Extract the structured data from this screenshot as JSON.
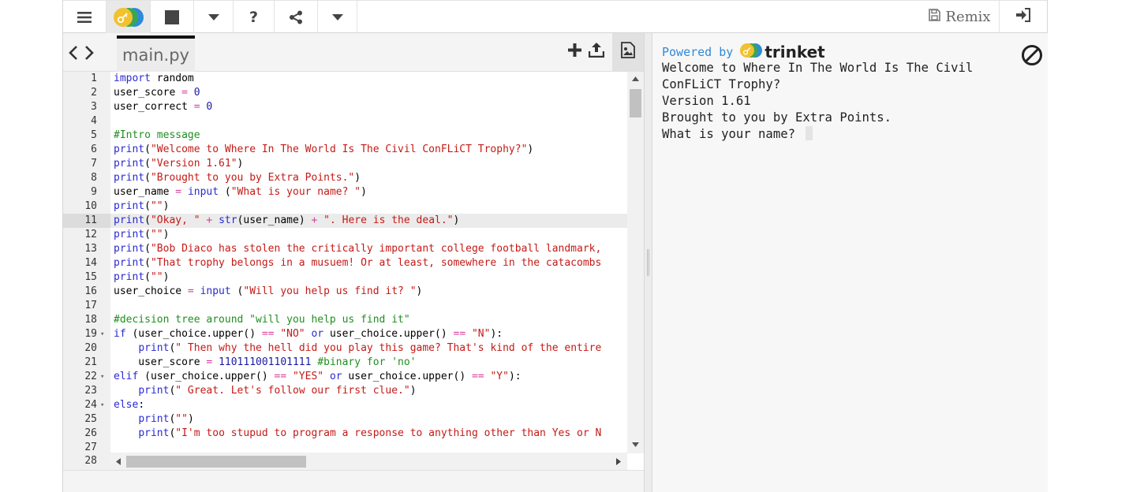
{
  "toolbar": {
    "remix_label": "Remix"
  },
  "editor": {
    "file_tab": "main.py",
    "active_line": 11,
    "last_line_number": "28",
    "lines": [
      {
        "n": "1",
        "fold": "",
        "html": "<span class=\"k\">import</span> random"
      },
      {
        "n": "2",
        "fold": "",
        "html": "user_score <span class=\"o\">=</span> <span class=\"n\">0</span>"
      },
      {
        "n": "3",
        "fold": "",
        "html": "user_correct <span class=\"o\">=</span> <span class=\"n\">0</span>"
      },
      {
        "n": "4",
        "fold": "",
        "html": ""
      },
      {
        "n": "5",
        "fold": "",
        "html": "<span class=\"c\">#Intro message</span>"
      },
      {
        "n": "6",
        "fold": "",
        "html": "<span class=\"k\">print</span>(<span class=\"s\">\"Welcome to Where In The World Is The Civil ConFLiCT Trophy?\"</span>)"
      },
      {
        "n": "7",
        "fold": "",
        "html": "<span class=\"k\">print</span>(<span class=\"s\">\"Version 1.61\"</span>)"
      },
      {
        "n": "8",
        "fold": "",
        "html": "<span class=\"k\">print</span>(<span class=\"s\">\"Brought to you by Extra Points.\"</span>)"
      },
      {
        "n": "9",
        "fold": "",
        "html": "user_name <span class=\"o\">=</span> <span class=\"k\">input</span> (<span class=\"s\">\"What is your name? \"</span>)"
      },
      {
        "n": "10",
        "fold": "",
        "html": "<span class=\"k\">print</span>(<span class=\"s\">\"\"</span>)"
      },
      {
        "n": "11",
        "fold": "",
        "html": "<span class=\"k\">print</span>(<span class=\"s\">\"Okay, \"</span> <span class=\"o\">+</span> <span class=\"k\">str</span>(user_name) <span class=\"o\">+</span> <span class=\"s\">\". Here is the deal.\"</span>)"
      },
      {
        "n": "12",
        "fold": "",
        "html": "<span class=\"k\">print</span>(<span class=\"s\">\"\"</span>)"
      },
      {
        "n": "13",
        "fold": "",
        "html": "<span class=\"k\">print</span>(<span class=\"s\">\"Bob Diaco has stolen the critically important college football landmark,</span>"
      },
      {
        "n": "14",
        "fold": "",
        "html": "<span class=\"k\">print</span>(<span class=\"s\">\"That trophy belongs in a musuem! Or at least, somewhere in the catacombs</span>"
      },
      {
        "n": "15",
        "fold": "",
        "html": "<span class=\"k\">print</span>(<span class=\"s\">\"\"</span>)"
      },
      {
        "n": "16",
        "fold": "",
        "html": "user_choice <span class=\"o\">=</span> <span class=\"k\">input</span> (<span class=\"s\">\"Will you help us find it? \"</span>)"
      },
      {
        "n": "17",
        "fold": "",
        "html": ""
      },
      {
        "n": "18",
        "fold": "",
        "html": "<span class=\"c\">#decision tree around \"will you help us find it\"</span>"
      },
      {
        "n": "19",
        "fold": "▾",
        "html": "<span class=\"k\">if</span> (user_choice.upper() <span class=\"o\">==</span> <span class=\"s\">\"NO\"</span> <span class=\"k\">or</span> user_choice.upper() <span class=\"o\">==</span> <span class=\"s\">\"N\"</span>):"
      },
      {
        "n": "20",
        "fold": "",
        "html": "    <span class=\"k\">print</span>(<span class=\"s\">\" Then why the hell did you play this game? That's kind of the entire</span>"
      },
      {
        "n": "21",
        "fold": "",
        "html": "    user_score <span class=\"o\">=</span> <span class=\"n\">110111001101111</span> <span class=\"c\">#binary for 'no'</span>"
      },
      {
        "n": "22",
        "fold": "▾",
        "html": "<span class=\"k\">elif</span> (user_choice.upper() <span class=\"o\">==</span> <span class=\"s\">\"YES\"</span> <span class=\"k\">or</span> user_choice.upper() <span class=\"o\">==</span> <span class=\"s\">\"Y\"</span>):"
      },
      {
        "n": "23",
        "fold": "",
        "html": "    <span class=\"k\">print</span>(<span class=\"s\">\" Great. Let's follow our first clue.\"</span>)"
      },
      {
        "n": "24",
        "fold": "▾",
        "html": "<span class=\"k\">else</span>:"
      },
      {
        "n": "25",
        "fold": "",
        "html": "    <span class=\"k\">print</span>(<span class=\"s\">\"\"</span>)"
      },
      {
        "n": "26",
        "fold": "",
        "html": "    <span class=\"k\">print</span>(<span class=\"s\">\"I'm too stupud to program a response to anything other than Yes or N</span>"
      },
      {
        "n": "27",
        "fold": "",
        "html": ""
      }
    ]
  },
  "output": {
    "powered_by": "Powered by",
    "brand": "trinket",
    "console_text": "Welcome to Where In The World Is The Civil\nConFLiCT Trophy?\nVersion 1.61\nBrought to you by Extra Points.\nWhat is your name? "
  },
  "icons": {
    "menu": "menu-icon",
    "logo": "trinket-logo-icon",
    "stop": "stop-icon",
    "dropdown": "caret-down-icon",
    "help": "help-icon",
    "share": "share-icon",
    "remix": "save-icon",
    "login": "sign-in-icon",
    "back": "chevron-left-icon",
    "forward": "chevron-right-icon",
    "add_file": "plus-icon",
    "upload": "upload-icon",
    "image_library": "image-icon",
    "clear_output": "ban-icon"
  },
  "colors": {
    "accent_blue": "#2f8ad8",
    "logo_yellow": "#f2c12e",
    "logo_green": "#3aa655",
    "logo_blue": "#2f8ad8"
  }
}
